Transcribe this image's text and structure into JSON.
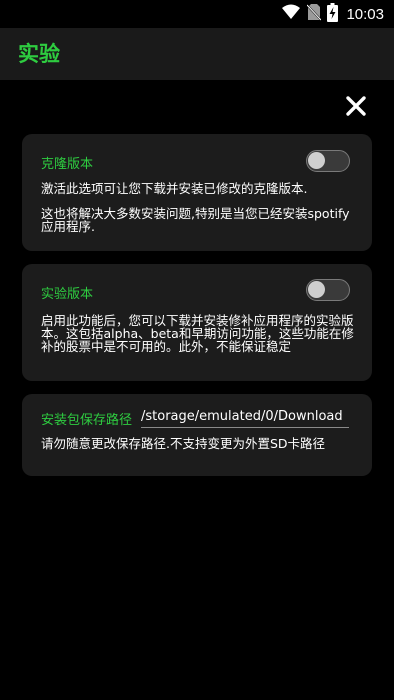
{
  "status_bar": {
    "time": "10:03",
    "icons": [
      "wifi-icon",
      "no-sim-icon",
      "battery-charging-icon"
    ]
  },
  "app_bar": {
    "title": "实验"
  },
  "close_button": {
    "icon": "close-icon"
  },
  "cards": [
    {
      "title": "克隆版本",
      "toggle_on": false,
      "description": [
        "激活此选项可让您下载并安装已修改的克隆版本.",
        "这也将解决大多数安装问题,特别是当您已经安装spotify应用程序."
      ]
    },
    {
      "title": "实验版本",
      "toggle_on": false,
      "description": [
        "启用此功能后，您可以下载并安装修补应用程序的实验版本。这包括alpha、beta和早期访问功能，这些功能在修补的股票中是不可用的。此外，不能保证稳定"
      ]
    },
    {
      "title": "安装包保存路径",
      "path_value": "/storage/emulated/0/Download",
      "description": [
        "请勿随意更改保存路径.不支持变更为外置SD卡路径"
      ]
    }
  ],
  "colors": {
    "accent": "#2ecc40",
    "background": "#000000",
    "app_bar": "#1a1a1a",
    "card": "#1c1c1c"
  }
}
